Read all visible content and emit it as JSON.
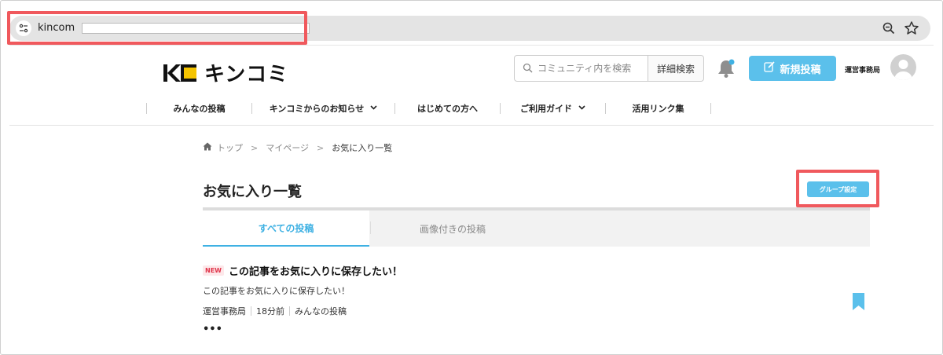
{
  "browser": {
    "url": "kincom",
    "icons": {
      "site_info": "site-info-icon",
      "zoom": "zoom-icon",
      "bookmark": "star-icon"
    }
  },
  "site": {
    "logo_text": "キンコミ",
    "search": {
      "placeholder": "コミュニティ内を検索",
      "advanced_label": "詳細検索"
    },
    "new_post_label": "新規投稿",
    "user_name": "運営事務局",
    "accent_color": "#5bc0eb"
  },
  "nav": {
    "items": [
      {
        "label": "みんなの投稿",
        "dropdown": false
      },
      {
        "label": "キンコミからのお知らせ",
        "dropdown": true
      },
      {
        "label": "はじめての方へ",
        "dropdown": false
      },
      {
        "label": "ご利用ガイド",
        "dropdown": true
      },
      {
        "label": "活用リンク集",
        "dropdown": false
      }
    ]
  },
  "breadcrumb": {
    "home": "トップ",
    "mypage": "マイページ",
    "current": "お気に入り一覧",
    "sep": ">"
  },
  "page": {
    "title": "お気に入り一覧",
    "group_settings_label": "グループ設定"
  },
  "tabs": [
    {
      "label": "すべての投稿",
      "active": true
    },
    {
      "label": "画像付きの投稿",
      "active": false
    }
  ],
  "post": {
    "badge": "NEW",
    "title": "この記事をお気に入りに保存したい！",
    "excerpt": "この記事をお気に入りに保存したい！",
    "author": "運営事務局",
    "time": "18分前",
    "category": "みんなの投稿",
    "more": "•••"
  }
}
